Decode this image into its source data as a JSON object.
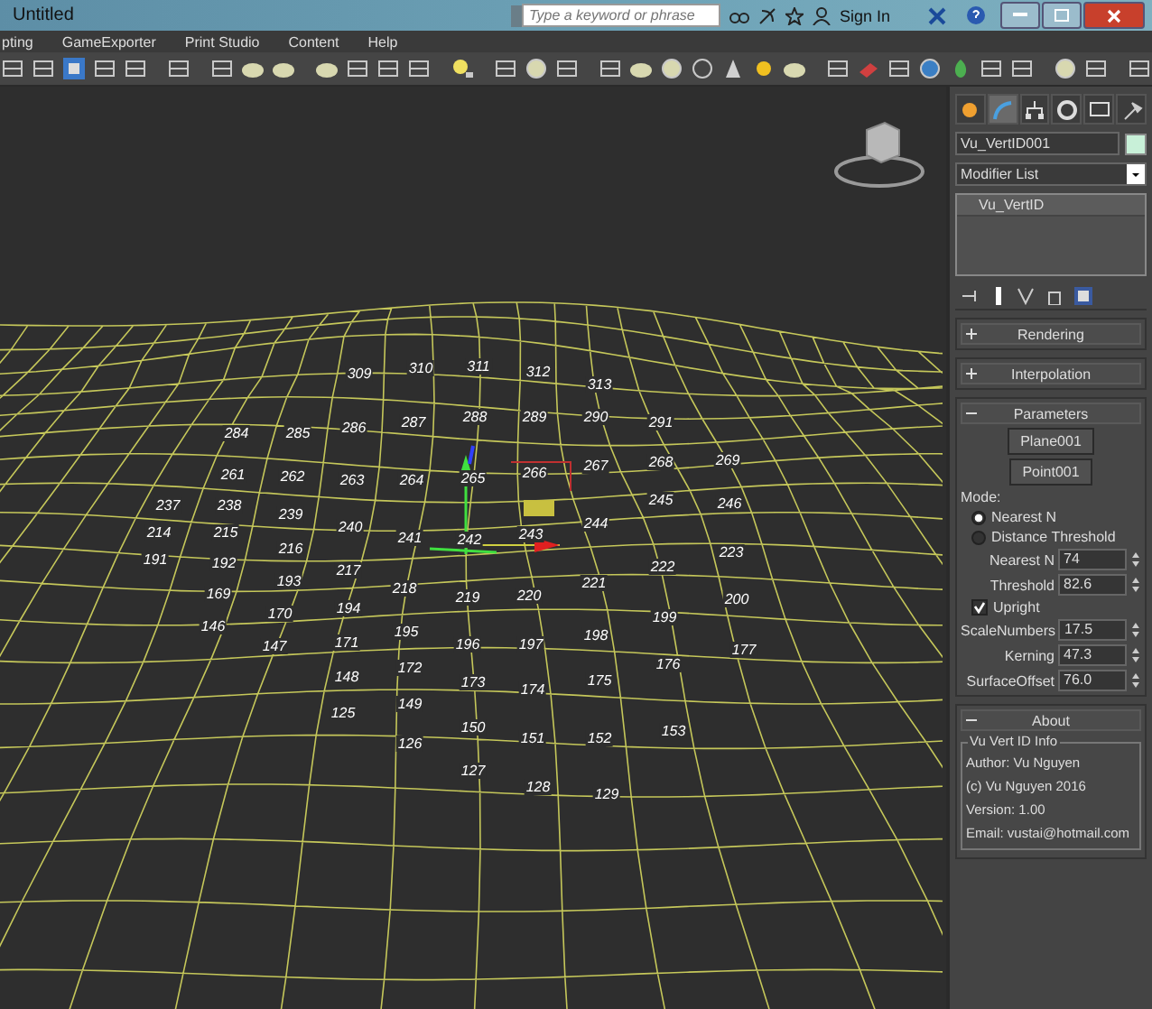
{
  "window": {
    "title": "Untitled"
  },
  "search": {
    "placeholder": "Type a keyword or phrase"
  },
  "sign_in": "Sign In",
  "menu": [
    "pting",
    "GameExporter",
    "Print Studio",
    "Content",
    "Help"
  ],
  "viewport": {
    "vertex_labels": [
      "309",
      "310",
      "311",
      "312",
      "313",
      "284",
      "285",
      "286",
      "287",
      "288",
      "289",
      "290",
      "291",
      "261",
      "262",
      "263",
      "264",
      "265",
      "266",
      "267",
      "268",
      "269",
      "237",
      "238",
      "239",
      "240",
      "241",
      "242",
      "243",
      "244",
      "245",
      "246",
      "214",
      "215",
      "216",
      "217",
      "218",
      "219",
      "220",
      "221",
      "222",
      "223",
      "191",
      "192",
      "193",
      "194",
      "195",
      "196",
      "197",
      "198",
      "199",
      "200",
      "169",
      "170",
      "171",
      "172",
      "173",
      "174",
      "175",
      "176",
      "177",
      "146",
      "147",
      "148",
      "149",
      "150",
      "151",
      "152",
      "153",
      "125",
      "126",
      "127",
      "128",
      "129"
    ]
  },
  "command_panel": {
    "tabs": [
      {
        "selected": false
      },
      {
        "selected": true
      },
      {
        "selected": false
      },
      {
        "selected": false
      },
      {
        "selected": false
      },
      {
        "selected": false
      }
    ],
    "object_name": "Vu_VertID001",
    "modifier_list": "Modifier List",
    "stack": [
      {
        "label": "Vu_VertID",
        "selected": true
      }
    ],
    "rollouts": [
      {
        "title": "Rendering",
        "kind": "empty",
        "expanded": false
      },
      {
        "title": "Interpolation",
        "kind": "empty",
        "expanded": false
      },
      {
        "title": "Parameters",
        "kind": "parameters",
        "expanded": true,
        "buttons": [
          "Plane001",
          "Point001"
        ],
        "mode_label": "Mode:",
        "modes": [
          {
            "label": "Nearest N",
            "selected": true
          },
          {
            "label": "Distance Threshold",
            "selected": false
          }
        ],
        "spinners_a": [
          {
            "label": "Nearest N",
            "value": "74"
          },
          {
            "label": "Threshold",
            "value": "82.6"
          }
        ],
        "upright": {
          "label": "Upright",
          "checked": true
        },
        "spinners_b": [
          {
            "label": "ScaleNumbers",
            "value": "17.5"
          },
          {
            "label": "Kerning",
            "value": "47.3"
          },
          {
            "label": "SurfaceOffset",
            "value": "76.0"
          }
        ]
      },
      {
        "title": "About",
        "kind": "about",
        "expanded": true,
        "group_title": "Vu Vert ID Info",
        "lines": [
          "Author: Vu Nguyen",
          "(c) Vu Nguyen 2016",
          "Version: 1.00",
          "Email: vustai@hotmail.com"
        ]
      }
    ]
  }
}
